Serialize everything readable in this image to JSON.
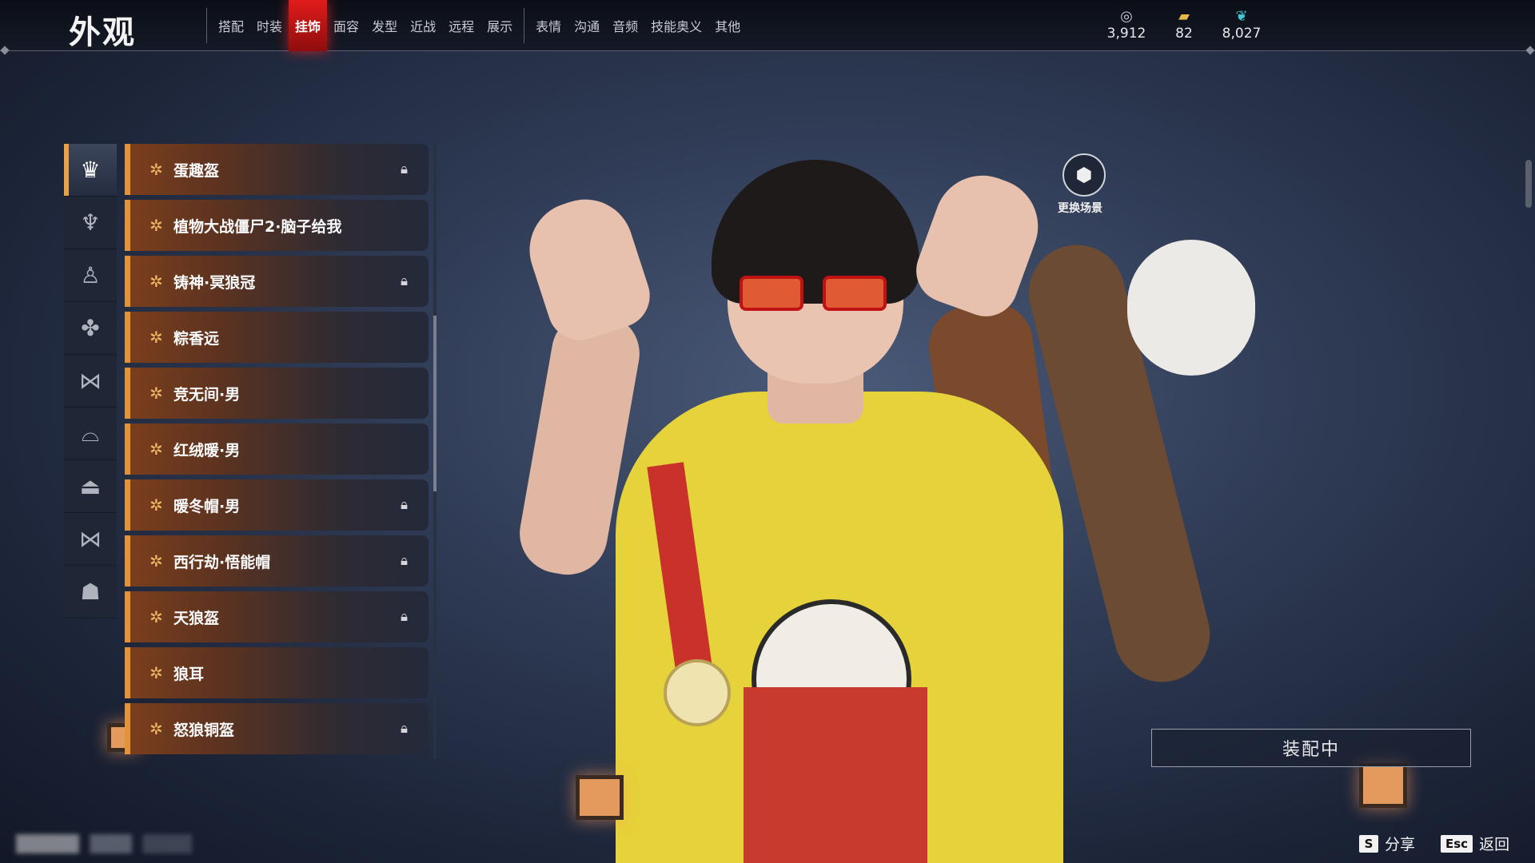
{
  "header": {
    "title": "外观",
    "tabs": [
      {
        "label": "搭配"
      },
      {
        "label": "时装"
      },
      {
        "label": "挂饰",
        "active": true
      },
      {
        "label": "面容"
      },
      {
        "label": "发型"
      },
      {
        "label": "近战"
      },
      {
        "label": "远程"
      },
      {
        "label": "展示"
      },
      {
        "label": "表情"
      },
      {
        "label": "沟通"
      },
      {
        "label": "音频"
      },
      {
        "label": "技能奥义"
      },
      {
        "label": "其他"
      }
    ],
    "currencies": [
      {
        "icon": "coin-icon",
        "value": "3,912"
      },
      {
        "icon": "ticket-icon",
        "value": "82"
      },
      {
        "icon": "feather-icon",
        "value": "8,027"
      }
    ]
  },
  "categories": [
    {
      "icon": "head-ornament-icon",
      "active": true
    },
    {
      "icon": "hairpin-icon"
    },
    {
      "icon": "figure-icon"
    },
    {
      "icon": "back-ornament-icon"
    },
    {
      "icon": "bow-icon"
    },
    {
      "icon": "mask-icon"
    },
    {
      "icon": "hat-icon"
    },
    {
      "icon": "waist-icon"
    },
    {
      "icon": "demon-mask-icon"
    }
  ],
  "items": [
    {
      "name": "蛋趣盔",
      "locked": true
    },
    {
      "name": "植物大战僵尸2·脑子给我",
      "locked": false
    },
    {
      "name": "铸神·冥狼冠",
      "locked": true
    },
    {
      "name": "粽香远",
      "locked": false
    },
    {
      "name": "竞无间·男",
      "locked": false
    },
    {
      "name": "红绒暖·男",
      "locked": false
    },
    {
      "name": "暖冬帽·男",
      "locked": true
    },
    {
      "name": "西行劫·悟能帽",
      "locked": true
    },
    {
      "name": "天狼盔",
      "locked": true
    },
    {
      "name": "狼耳",
      "locked": false
    },
    {
      "name": "怒狼铜盔",
      "locked": true
    }
  ],
  "scene": {
    "label": "更换场景"
  },
  "equipped": {
    "label": "装配中"
  },
  "hints": [
    {
      "key": "S",
      "label": "分享"
    },
    {
      "key": "Esc",
      "label": "返回"
    }
  ],
  "colors": {
    "active_tab": "#e21b1b",
    "item_accent": "#e39338",
    "background": "#2f3b55"
  }
}
